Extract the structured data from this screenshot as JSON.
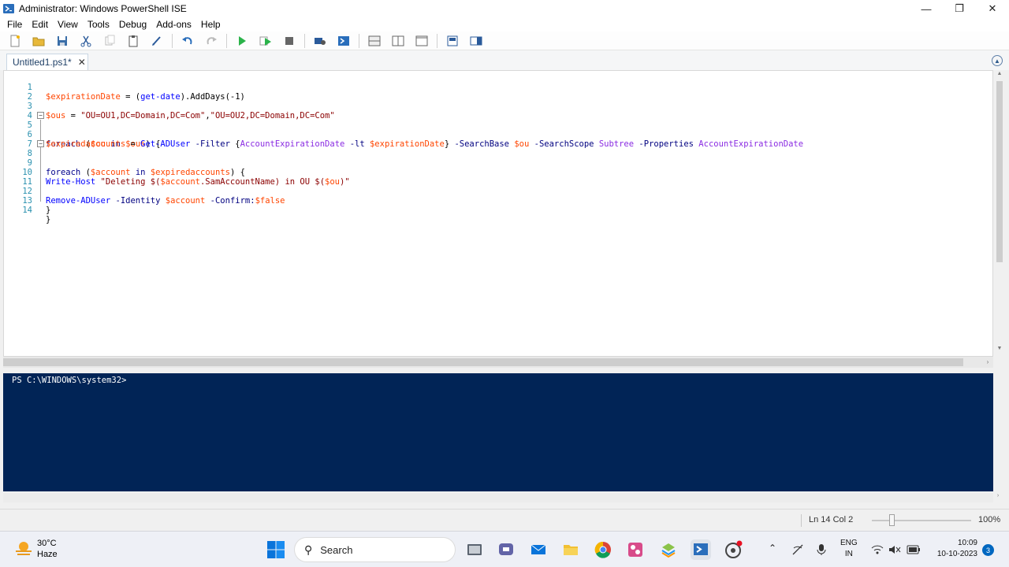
{
  "window": {
    "title": "Administrator: Windows PowerShell ISE",
    "minimize": "—",
    "maximize": "❐",
    "close": "✕"
  },
  "menu": [
    "File",
    "Edit",
    "View",
    "Tools",
    "Debug",
    "Add-ons",
    "Help"
  ],
  "toolbar": {
    "icons": [
      "new-file-icon",
      "open-folder-icon",
      "save-icon",
      "cut-icon",
      "copy-icon",
      "paste-icon",
      "clear-icon",
      "undo-icon",
      "redo-icon",
      "run-script-icon",
      "run-selection-icon",
      "stop-icon",
      "new-remote-tab-icon",
      "start-powershell-icon",
      "layout-top-icon",
      "layout-right-icon",
      "layout-max-icon",
      "show-script-pane-icon",
      "show-commands-icon"
    ]
  },
  "tabs": [
    {
      "label": "Untitled1.ps1*",
      "close": "✕"
    }
  ],
  "editor": {
    "lines": [
      {
        "n": "1",
        "text": "$expirationDate = (get-date).AddDays(-1)"
      },
      {
        "n": "2",
        "text": ""
      },
      {
        "n": "3",
        "text": "$ous = \"OU=OU1,DC=Domain,DC=Com\",\"OU=OU2,DC=Domain,DC=Com\""
      },
      {
        "n": "4",
        "text": ""
      },
      {
        "n": "5",
        "text": "foreach ($ou in $ous) {"
      },
      {
        "n": "6",
        "text": "$expiredaccounts = Get-ADUser -Filter {AccountExpirationDate -lt $expirationDate} -SearchBase $ou -SearchScope Subtree -Properties AccountExpirationDate"
      },
      {
        "n": "7",
        "text": ""
      },
      {
        "n": "8",
        "text": "foreach ($account in $expiredaccounts) {"
      },
      {
        "n": "9",
        "text": ""
      },
      {
        "n": "10",
        "text": "Write-Host \"Deleting $($account.SamAccountName) in OU $($ou)\""
      },
      {
        "n": "11",
        "text": ""
      },
      {
        "n": "12",
        "text": "Remove-ADUser -Identity $account -Confirm:$false"
      },
      {
        "n": "13",
        "text": "}"
      },
      {
        "n": "14",
        "text": "}"
      }
    ]
  },
  "console": {
    "prompt": "PS C:\\WINDOWS\\system32>"
  },
  "status": {
    "position": "Ln 14  Col 2",
    "zoom": "100%",
    "zoom_level": 0.2
  },
  "taskbar": {
    "weather_temp": "30°C",
    "weather_cond": "Haze",
    "search_label": "Search",
    "lang_top": "ENG",
    "lang_bottom": "IN",
    "time": "10:09",
    "date": "10-10-2023",
    "notifications": "3"
  }
}
